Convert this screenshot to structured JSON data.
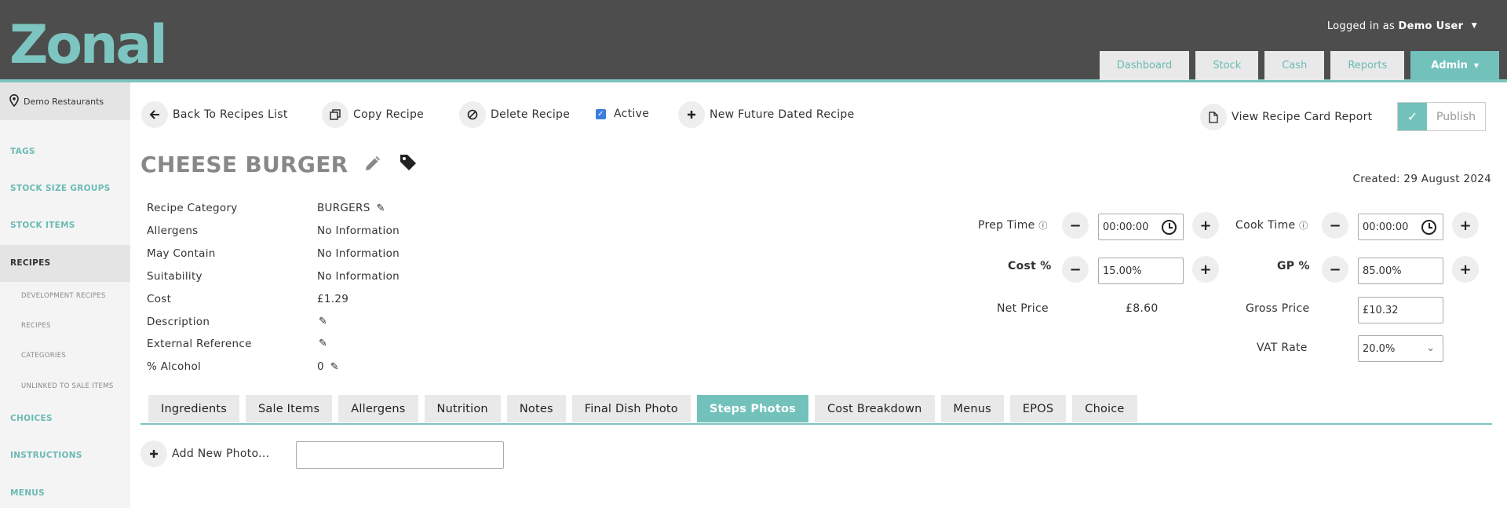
{
  "header": {
    "logo_text": "Zonal",
    "login_prefix": "Logged in as",
    "login_user": "Demo User",
    "nav": [
      {
        "label": "Dashboard"
      },
      {
        "label": "Stock"
      },
      {
        "label": "Cash"
      },
      {
        "label": "Reports"
      },
      {
        "label": "Admin"
      }
    ],
    "accent_color": "#73c1bb",
    "bar_color": "#4d4d4d"
  },
  "sidebar": {
    "location": "Demo Restaurants",
    "items": [
      {
        "label": "TAGS"
      },
      {
        "label": "STOCK SIZE GROUPS"
      },
      {
        "label": "STOCK ITEMS"
      },
      {
        "label": "RECIPES"
      },
      {
        "label": "CHOICES"
      },
      {
        "label": "INSTRUCTIONS"
      },
      {
        "label": "MENUS"
      }
    ],
    "sub_items": [
      {
        "label": "DEVELOPMENT RECIPES"
      },
      {
        "label": "RECIPES"
      },
      {
        "label": "CATEGORIES"
      },
      {
        "label": "UNLINKED TO SALE ITEMS"
      }
    ]
  },
  "toolbar": {
    "back": "Back To Recipes List",
    "copy": "Copy Recipe",
    "delete": "Delete Recipe",
    "active": "Active",
    "active_checked": true,
    "new_future": "New Future Dated Recipe",
    "view_report": "View Recipe Card Report",
    "publish": "Publish"
  },
  "recipe": {
    "title": "CHEESE BURGER",
    "created": "Created: 29 August 2024",
    "details": [
      {
        "label": "Recipe Category",
        "value": "BURGERS"
      },
      {
        "label": "Allergens",
        "value": "No Information"
      },
      {
        "label": "May Contain",
        "value": "No Information"
      },
      {
        "label": "Suitability",
        "value": "No Information"
      },
      {
        "label": "Cost",
        "value": "£1.29"
      },
      {
        "label": "Description",
        "value": ""
      },
      {
        "label": "External Reference",
        "value": ""
      },
      {
        "label": "% Alcohol",
        "value": "0"
      }
    ]
  },
  "pricing": {
    "prep_label": "Prep Time",
    "prep_value": "00:00:00",
    "cook_label": "Cook Time",
    "cook_value": "00:00:00",
    "cost_label": "Cost %",
    "cost_value": "15.00%",
    "gp_label": "GP %",
    "gp_value": "85.00%",
    "net_label": "Net Price",
    "net_value": "£8.60",
    "gross_label": "Gross Price",
    "gross_value": "£10.32",
    "vat_label": "VAT Rate",
    "vat_value": "20.0%"
  },
  "tabs": [
    {
      "label": "Ingredients"
    },
    {
      "label": "Sale Items"
    },
    {
      "label": "Allergens"
    },
    {
      "label": "Nutrition"
    },
    {
      "label": "Notes"
    },
    {
      "label": "Final Dish Photo"
    },
    {
      "label": "Steps Photos"
    },
    {
      "label": "Cost Breakdown"
    },
    {
      "label": "Menus"
    },
    {
      "label": "EPOS"
    },
    {
      "label": "Choice"
    }
  ],
  "active_tab": "Steps Photos",
  "photos": {
    "add_label": "Add New Photo...",
    "input_value": ""
  }
}
